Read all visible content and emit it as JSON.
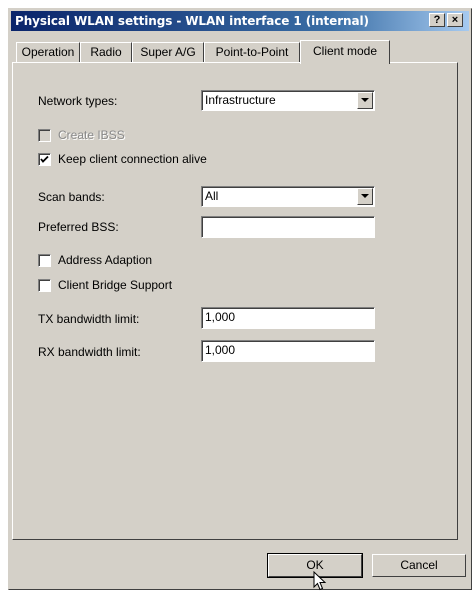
{
  "window": {
    "title": "Physical WLAN settings - WLAN interface 1 (internal)",
    "help_label": "?",
    "close_label": "×"
  },
  "tabs": [
    {
      "label": "Operation"
    },
    {
      "label": "Radio"
    },
    {
      "label": "Super A/G"
    },
    {
      "label": "Point-to-Point"
    },
    {
      "label": "Client mode"
    }
  ],
  "active_tab": "Client mode",
  "form": {
    "network_types": {
      "label": "Network types:",
      "value": "Infrastructure"
    },
    "create_ibss": {
      "label": "Create IBSS",
      "checked": false,
      "enabled": false
    },
    "keep_alive": {
      "label": "Keep client connection alive",
      "checked": true
    },
    "scan_bands": {
      "label": "Scan bands:",
      "value": "All"
    },
    "preferred_bss": {
      "label": "Preferred BSS:",
      "value": ""
    },
    "address_adaption": {
      "label": "Address Adaption",
      "checked": false
    },
    "client_bridge": {
      "label": "Client Bridge Support",
      "checked": false
    },
    "tx_limit": {
      "label": "TX bandwidth limit:",
      "value": "1,000"
    },
    "rx_limit": {
      "label": "RX bandwidth limit:",
      "value": "1,000"
    }
  },
  "buttons": {
    "ok": "OK",
    "cancel": "Cancel"
  },
  "colors": {
    "face": "#d4d0c8",
    "title_start": "#0a246a",
    "title_end": "#a6caf0"
  }
}
